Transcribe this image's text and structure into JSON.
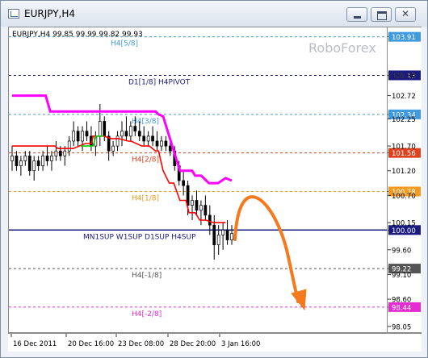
{
  "window": {
    "title": "EURJPY,H4",
    "icon": "chart-window-icon"
  },
  "chart_header": {
    "symbol_text": "EURJPY,H4  99.85 99.99 99.82 99.93"
  },
  "watermark": "RoboForex",
  "price_scale": {
    "min": 97.9,
    "max": 104.1
  },
  "chart_data": {
    "type": "line",
    "symbol": "EURJPY",
    "timeframe": "H4",
    "ohlc_last": {
      "open": 99.85,
      "high": 99.99,
      "low": 99.82,
      "close": 99.93
    },
    "y_ticks": [
      103.91,
      103.13,
      102.34,
      101.56,
      100.78,
      100.0,
      99.22,
      98.44,
      103.13,
      102.72,
      102.25,
      101.7,
      101.2,
      100.7,
      100.15,
      99.6,
      99.1,
      98.6,
      98.05
    ],
    "y_tick_labels": [
      "103.91",
      "103.13",
      "102.34",
      "101.56",
      "100.78",
      "100.00",
      "99.22",
      "98.44",
      "103.30",
      "102.72",
      "102.25",
      "101.70",
      "101.20",
      "100.70",
      "100.15",
      "99.60",
      "99.10",
      "98.60",
      "98.05"
    ],
    "x_tick_labels": [
      "16 Dec 2011",
      "20 Dec 16:00",
      "23 Dec 08:00",
      "28 Dec 20:00",
      "3 Jan 16:00"
    ],
    "levels": [
      {
        "label": "H4[5/8]",
        "price": 103.91,
        "color": "#3f9adf",
        "style": "dash",
        "tag_color": "#3f9adf"
      },
      {
        "label": "D1[1/8] H4PIVOT",
        "price": 103.13,
        "color": "#1a1a80",
        "style": "dash",
        "tag_color": "#1a1a80"
      },
      {
        "label": "H4[3/8]",
        "price": 102.34,
        "color": "#3f9adf",
        "style": "dash",
        "tag_color": "#3f9adf"
      },
      {
        "label": "H4[2/8]",
        "price": 101.56,
        "color": "#e0421e",
        "style": "dash",
        "tag_color": "#e0421e"
      },
      {
        "label": "H4[1/8]",
        "price": 100.78,
        "color": "#f29a22",
        "style": "dash",
        "tag_color": "#f29a22"
      },
      {
        "label": "MN1SUP W1SUP D1SUP H4SUP",
        "price": 100.0,
        "color": "#1a1a80",
        "style": "solid",
        "tag_color": "#1a1a80"
      },
      {
        "label": "H4[-1/8]",
        "price": 99.22,
        "color": "#555555",
        "style": "dash",
        "tag_color": "#555555"
      },
      {
        "label": "H4[-2/8]",
        "price": 98.44,
        "color": "#e62bd3",
        "style": "dash",
        "tag_color": "#e62bd3"
      }
    ],
    "series": [
      {
        "name": "",
        "color": "#ff00ff",
        "kind": "magenta-trail",
        "x": [
          0,
          22,
          25,
          28,
          82,
          94,
          96,
          99,
          107,
          110,
          118,
          120,
          124,
          129,
          135,
          140,
          144
        ],
        "y": [
          102.72,
          102.72,
          102.4,
          102.4,
          102.4,
          102.4,
          102.34,
          102.3,
          101.5,
          101.2,
          101.2,
          101.1,
          101.1,
          100.95,
          100.95,
          101.05,
          101.0
        ]
      },
      {
        "name": "",
        "color": "#ff0000",
        "kind": "red-trail",
        "x": [
          0,
          28,
          30,
          40,
          48,
          52,
          53,
          60,
          65,
          70,
          76,
          78,
          85,
          90,
          94,
          96,
          99,
          103,
          106,
          110,
          114,
          116,
          120,
          123,
          127,
          132,
          136,
          140
        ],
        "y": [
          101.7,
          101.7,
          101.65,
          101.65,
          101.75,
          101.75,
          101.9,
          101.9,
          101.85,
          101.85,
          101.8,
          101.8,
          101.7,
          101.7,
          101.6,
          101.6,
          101.2,
          100.95,
          100.95,
          100.6,
          100.6,
          100.35,
          100.35,
          100.2,
          100.2,
          100.15,
          100.15,
          100.15
        ]
      },
      {
        "name": "",
        "color": "#00cc00",
        "kind": "green-trail",
        "x": [
          45,
          53,
          55,
          60
        ],
        "y": [
          101.7,
          101.7,
          101.9,
          101.9
        ]
      }
    ],
    "candles": [
      [
        0,
        101.4,
        101.7,
        101.2,
        101.5
      ],
      [
        1,
        101.5,
        101.6,
        101.2,
        101.3
      ],
      [
        2,
        101.3,
        101.5,
        101.1,
        101.4
      ],
      [
        3,
        101.4,
        101.6,
        101.3,
        101.5
      ],
      [
        4,
        101.5,
        101.6,
        101.1,
        101.2
      ],
      [
        5,
        101.2,
        101.5,
        101.0,
        101.4
      ],
      [
        6,
        101.4,
        101.5,
        101.2,
        101.3
      ],
      [
        7,
        101.3,
        101.6,
        101.2,
        101.5
      ],
      [
        8,
        101.5,
        101.7,
        101.3,
        101.4
      ],
      [
        9,
        101.4,
        101.6,
        101.2,
        101.5
      ],
      [
        10,
        101.5,
        101.8,
        101.4,
        101.6
      ],
      [
        11,
        101.6,
        101.7,
        101.4,
        101.5
      ],
      [
        12,
        101.5,
        101.7,
        101.3,
        101.6
      ],
      [
        13,
        101.6,
        101.9,
        101.5,
        101.8
      ],
      [
        14,
        101.8,
        102.2,
        101.7,
        102.0
      ],
      [
        15,
        102.0,
        102.1,
        101.7,
        101.8
      ],
      [
        16,
        101.8,
        102.1,
        101.6,
        102.0
      ],
      [
        17,
        102.0,
        102.2,
        101.8,
        101.9
      ],
      [
        18,
        101.9,
        102.1,
        101.6,
        101.7
      ],
      [
        19,
        101.7,
        102.0,
        101.5,
        101.9
      ],
      [
        20,
        101.9,
        102.55,
        101.7,
        102.2
      ],
      [
        21,
        102.2,
        102.3,
        101.8,
        101.9
      ],
      [
        22,
        101.9,
        102.0,
        101.4,
        101.6
      ],
      [
        23,
        101.6,
        101.8,
        101.5,
        101.7
      ],
      [
        24,
        101.7,
        102.0,
        101.6,
        101.9
      ],
      [
        25,
        101.9,
        102.2,
        101.7,
        102.0
      ],
      [
        26,
        102.0,
        102.3,
        101.8,
        101.9
      ],
      [
        27,
        101.9,
        102.2,
        101.8,
        102.1
      ],
      [
        28,
        102.1,
        102.3,
        101.9,
        102.0
      ],
      [
        29,
        102.0,
        102.2,
        101.8,
        101.9
      ],
      [
        30,
        101.9,
        102.1,
        101.7,
        101.8
      ],
      [
        31,
        101.8,
        102.0,
        101.7,
        101.9
      ],
      [
        32,
        101.9,
        102.1,
        101.7,
        101.8
      ],
      [
        33,
        101.8,
        102.0,
        101.6,
        101.7
      ],
      [
        34,
        101.7,
        101.9,
        101.6,
        101.8
      ],
      [
        35,
        101.8,
        101.9,
        101.6,
        101.7
      ],
      [
        36,
        101.7,
        101.8,
        101.5,
        101.6
      ],
      [
        37,
        101.6,
        101.7,
        101.2,
        101.3
      ],
      [
        38,
        101.3,
        101.4,
        100.9,
        101.0
      ],
      [
        39,
        101.0,
        101.2,
        100.7,
        100.9
      ],
      [
        40,
        100.9,
        101.0,
        100.3,
        100.5
      ],
      [
        41,
        100.5,
        100.7,
        100.2,
        100.6
      ],
      [
        42,
        100.6,
        100.8,
        100.3,
        100.4
      ],
      [
        43,
        100.4,
        100.6,
        100.1,
        100.5
      ],
      [
        44,
        100.5,
        100.7,
        100.2,
        100.3
      ],
      [
        45,
        100.3,
        100.5,
        99.9,
        100.1
      ],
      [
        46,
        100.1,
        100.3,
        99.4,
        99.7
      ],
      [
        47,
        99.7,
        100.1,
        99.5,
        99.9
      ],
      [
        48,
        99.9,
        100.15,
        99.6,
        100.0
      ],
      [
        49,
        100.0,
        100.2,
        99.7,
        99.8
      ],
      [
        50,
        99.8,
        100.1,
        99.7,
        99.93
      ]
    ]
  },
  "forecast_arrow": {
    "color": "#f47a1f"
  }
}
